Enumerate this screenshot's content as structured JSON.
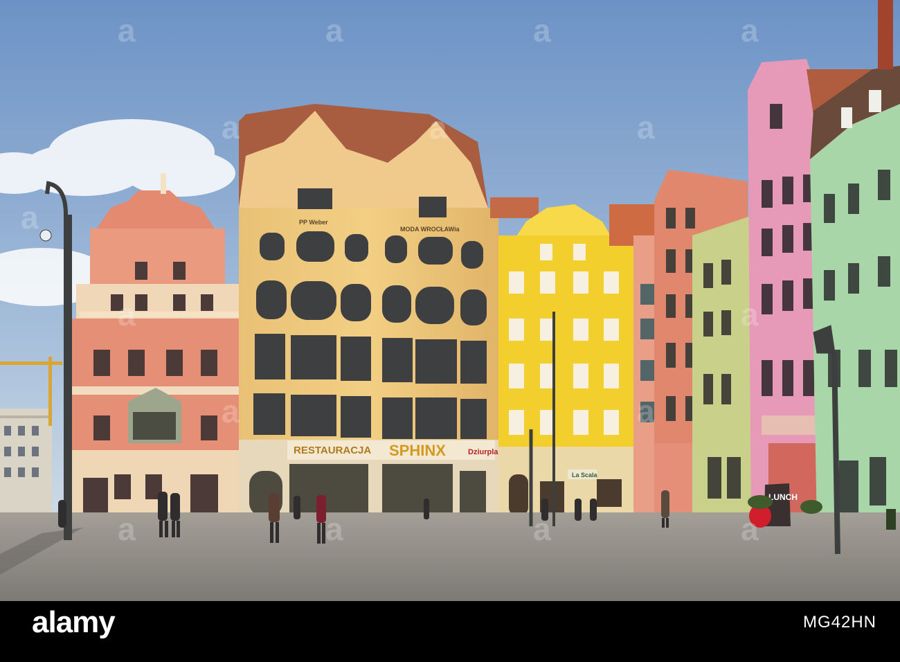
{
  "photo": {
    "scene": "market-square",
    "signs": {
      "restauracja": "RESTAURACJA",
      "sphinx": "SPHINX",
      "dziurpla": "Dziurpla",
      "moda": "MODA WROCŁAWia",
      "weber": "PP Weber",
      "lunch": "LUNCH",
      "la_scala": "La Scala"
    }
  },
  "watermark": {
    "brand": "a",
    "brand_word": "alamy"
  },
  "footer": {
    "logo": "alamy",
    "image_id": "MG42HN"
  },
  "colors": {
    "sky_top": "#6d93c6",
    "sky_bottom": "#c7d7e6",
    "cobble": "#8e8b86",
    "footer": "#000000"
  }
}
